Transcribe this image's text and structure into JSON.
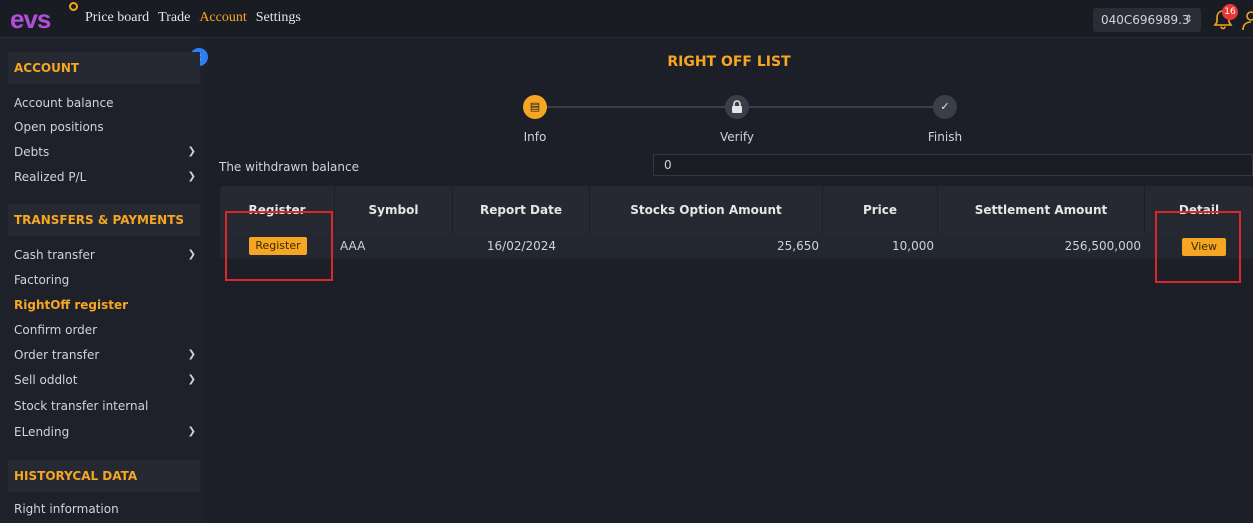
{
  "topbar": {
    "logo": "evs",
    "nav": [
      "Price board",
      "Trade",
      "Account",
      "Settings"
    ],
    "active_nav": "Account",
    "account_number": "040C696989.3",
    "notification_count": "16"
  },
  "sidebar": {
    "sections": [
      {
        "title": "ACCOUNT"
      },
      {
        "title": "TRANSFERS & PAYMENTS"
      },
      {
        "title": "HISTORYCAL DATA"
      }
    ],
    "account_items": [
      {
        "label": "Account balance"
      },
      {
        "label": "Open positions"
      },
      {
        "label": "Debts"
      },
      {
        "label": "Realized P/L"
      }
    ],
    "transfer_items": [
      {
        "label": "Cash transfer"
      },
      {
        "label": "Factoring"
      },
      {
        "label": "RightOff register"
      },
      {
        "label": "Confirm order"
      },
      {
        "label": "Order transfer"
      },
      {
        "label": "Sell oddlot"
      },
      {
        "label": "Stock transfer internal"
      },
      {
        "label": "ELending"
      }
    ],
    "history_items": [
      {
        "label": "Right information"
      }
    ]
  },
  "main": {
    "title": "RIGHT OFF LIST",
    "steps": [
      {
        "label": "Info",
        "state": "active",
        "icon": "keyboard-icon"
      },
      {
        "label": "Verify",
        "state": "pending",
        "icon": "lock-icon"
      },
      {
        "label": "Finish",
        "state": "pending",
        "icon": "check-icon"
      }
    ],
    "withdrawn_label": "The withdrawn balance",
    "withdrawn_value": "0",
    "table": {
      "headers": [
        "Register",
        "Symbol",
        "Report Date",
        "Stocks Option Amount",
        "Price",
        "Settlement Amount",
        "Detail"
      ],
      "rows": [
        {
          "register_btn": "Register",
          "symbol": "AAA",
          "report_date": "16/02/2024",
          "stocks_option_amount": "25,650",
          "price": "10,000",
          "settlement_amount": "256,500,000",
          "detail_btn": "View"
        }
      ]
    }
  },
  "colors": {
    "accent": "#f5a623",
    "highlight_box": "#d62a2a",
    "background": "#1c1f27"
  }
}
